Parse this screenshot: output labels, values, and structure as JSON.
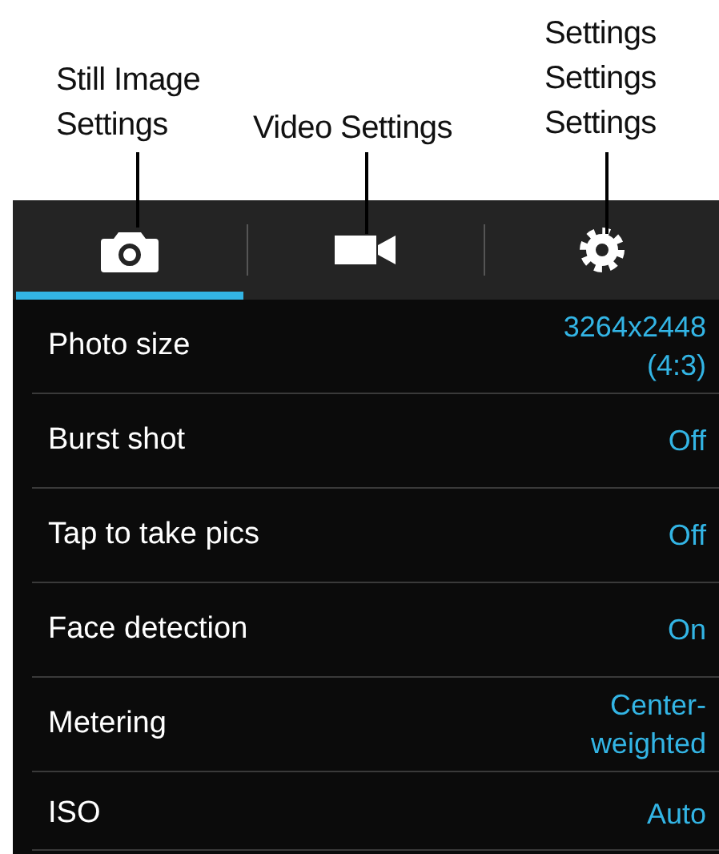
{
  "callouts": [
    {
      "lines": [
        "Still Image",
        "Settings"
      ]
    },
    {
      "lines": [
        "Video Settings"
      ]
    },
    {
      "lines": [
        "Settings",
        "Settings",
        "Settings"
      ]
    }
  ],
  "tabs": [
    {
      "kind": "camera",
      "selected": true
    },
    {
      "kind": "video",
      "selected": false
    },
    {
      "kind": "gear",
      "selected": false
    }
  ],
  "settings": [
    {
      "label": "Photo size",
      "value": [
        "3264x2448",
        "(4:3)"
      ]
    },
    {
      "label": "Burst shot",
      "value": [
        "Off"
      ]
    },
    {
      "label": "Tap to take pics",
      "value": [
        "Off"
      ]
    },
    {
      "label": "Face detection",
      "value": [
        "On"
      ]
    },
    {
      "label": "Metering",
      "value": [
        "Center-",
        "weighted"
      ]
    },
    {
      "label": "ISO",
      "value": [
        "Auto"
      ]
    }
  ]
}
